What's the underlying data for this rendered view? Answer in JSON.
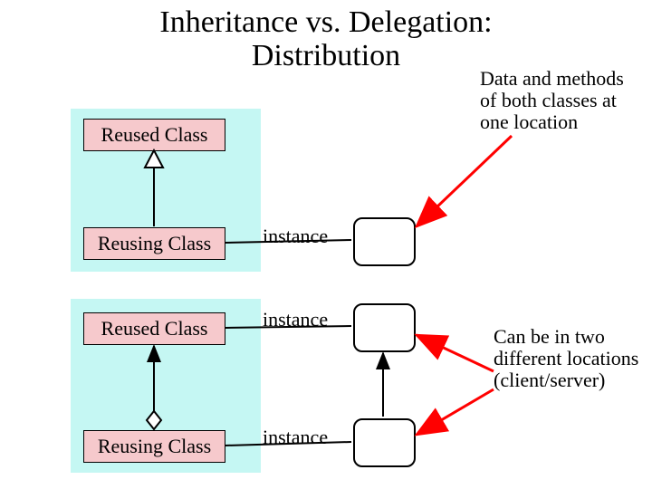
{
  "title_line1": "Inheritance vs. Delegation:",
  "title_line2": "Distribution",
  "boxes": {
    "top_reused": "Reused Class",
    "top_reusing": "Reusing Class",
    "bot_reused": "Reused Class",
    "bot_reusing": "Reusing Class"
  },
  "labels": {
    "inst1": "instance",
    "inst2": "instance",
    "inst3": "instance"
  },
  "annotations": {
    "top": "Data and methods of both classes at one location",
    "bottom": "Can be in two different locations (client/server)"
  },
  "colors": {
    "panel": "#c5f7f3",
    "classbox": "#f6c9cc",
    "arrow_red": "#ff0000"
  }
}
